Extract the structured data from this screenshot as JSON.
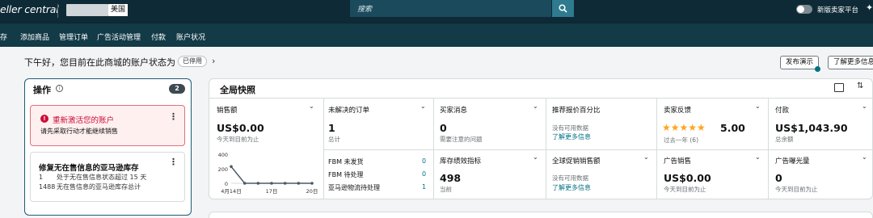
{
  "topbar": {
    "brand": "eller central",
    "region_badge": "美国",
    "search_placeholder": "搜索",
    "toggle_label": "新版卖家平台",
    "spark": "✦"
  },
  "nav": {
    "items": [
      "存",
      "添加商品",
      "管理订单",
      "广告活动管理",
      "付款",
      "账户状况"
    ]
  },
  "greeting": {
    "text": "下午好，您目前在此商城的账户状态为",
    "status_badge": "已停用",
    "chevron": "›",
    "publish_button": "发布演示",
    "learn_more_button": "了解更多信息"
  },
  "ops": {
    "title": "操作",
    "info": "i",
    "count": "2",
    "alert": {
      "icon": "!",
      "title": "重新激活您的账户",
      "body": "请先采取行动才能继续销售",
      "menu": "⋮"
    },
    "task": {
      "title": "修复无在售信息的亚马逊库存",
      "menu": "⋮",
      "lines": [
        {
          "num": "1",
          "text": "处于无在售信息状态超过 15 天"
        },
        {
          "num": "1488",
          "text": "无在售信息的亚马逊库存总计"
        }
      ]
    }
  },
  "snapshot": {
    "title": "全局快照",
    "chevron": "⌄",
    "sort_icon": "⇅",
    "sales": {
      "label": "销售额",
      "value": "US$0.00",
      "sub": "今天到目前为止"
    },
    "orders": {
      "label": "未解决的订单",
      "value": "1",
      "sub": "总计",
      "rows": [
        {
          "label": "FBM 未发货",
          "value": "0"
        },
        {
          "label": "FBM 待处理",
          "value": "0"
        },
        {
          "label": "亚马逊物流待处理",
          "value": "1"
        }
      ]
    },
    "buyer_messages": {
      "label": "买家消息",
      "value": "0",
      "sub": "需要注意的问题"
    },
    "inventory_perf": {
      "label": "库存绩效指标",
      "value": "498",
      "sub": "当前"
    },
    "featured_offer": {
      "label": "推荐报价百分比",
      "no_data": "没有可用数据",
      "link": "了解更多信息"
    },
    "global_promo": {
      "label": "全球促销销售额",
      "no_data": "没有可用数据",
      "link": "了解更多信息"
    },
    "feedback": {
      "label": "卖家反馈",
      "stars": "★★★★★",
      "rating": 5.0,
      "rating_text": "5.00",
      "sub": "过去一年 (6)"
    },
    "ad_sales": {
      "label": "广告销售",
      "value": "US$0.00",
      "sub": "今天到目前为止"
    },
    "payments": {
      "label": "付款",
      "value": "US$1,043.90",
      "sub": "总余额"
    },
    "ad_impressions": {
      "label": "广告曝光量",
      "value": "0",
      "sub": "今天到目前为止"
    }
  },
  "chart_data": {
    "type": "line",
    "x": [
      "4月14日",
      "4月15日",
      "4月16日",
      "4月17日",
      "4月18日",
      "4月19日",
      "4月20日"
    ],
    "x_tick_labels": [
      "4月14日",
      "17日",
      "20日"
    ],
    "values": [
      230,
      0,
      0,
      0,
      0,
      0,
      0
    ],
    "ylim": [
      0,
      400
    ],
    "y_ticks": [
      "400",
      "200",
      "0"
    ],
    "color": "#4a5a66"
  }
}
